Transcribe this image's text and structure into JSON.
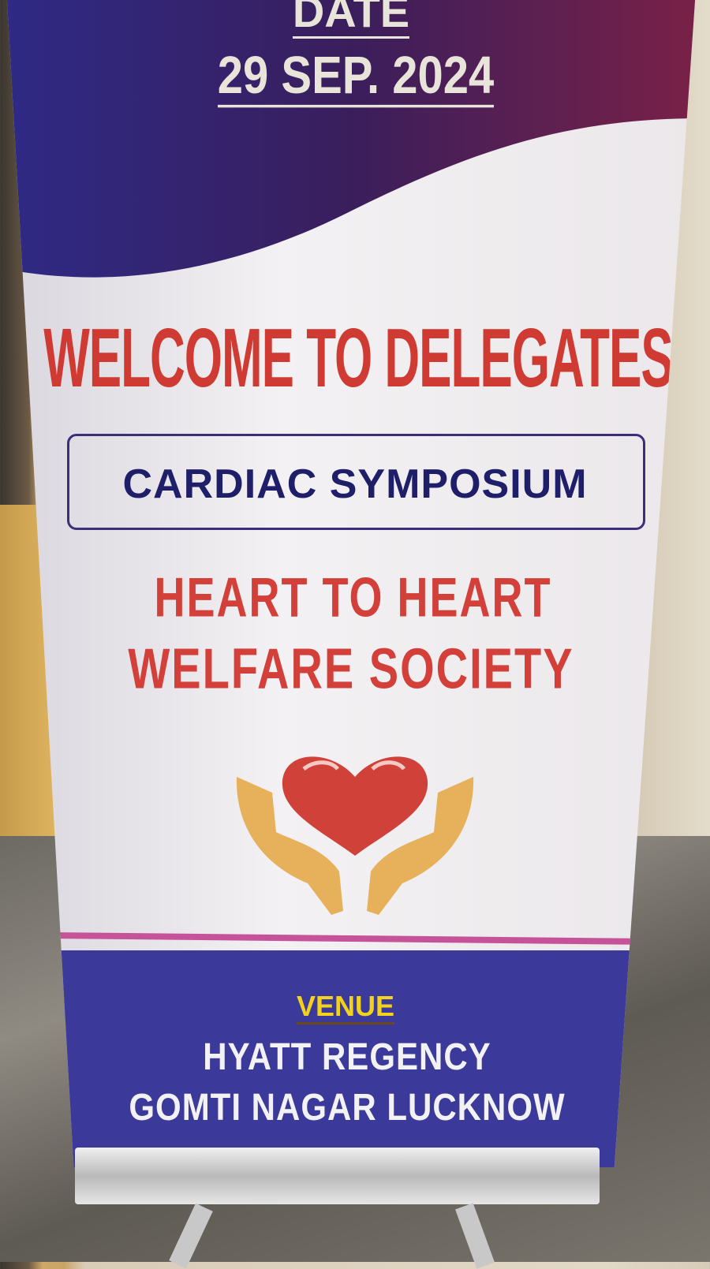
{
  "banner": {
    "date_label": "DATE",
    "date_value": "29 SEP. 2024",
    "welcome": "WELCOME TO DELEGATES",
    "event_name": "CARDIAC SYMPOSIUM",
    "organizer_line1": "HEART TO HEART",
    "organizer_line2": "WELFARE SOCIETY",
    "logo_icon": "hands-holding-heart-icon",
    "venue_label": "VENUE",
    "venue_line1": "HYATT REGENCY",
    "venue_line2": "GOMTI NAGAR LUCKNOW"
  },
  "colors": {
    "title_red": "#cf3b33",
    "navy": "#1f1e68",
    "venue_blue": "#3b3a9a",
    "venue_yellow": "#f2d21c",
    "accent_pink": "#c6529a"
  }
}
